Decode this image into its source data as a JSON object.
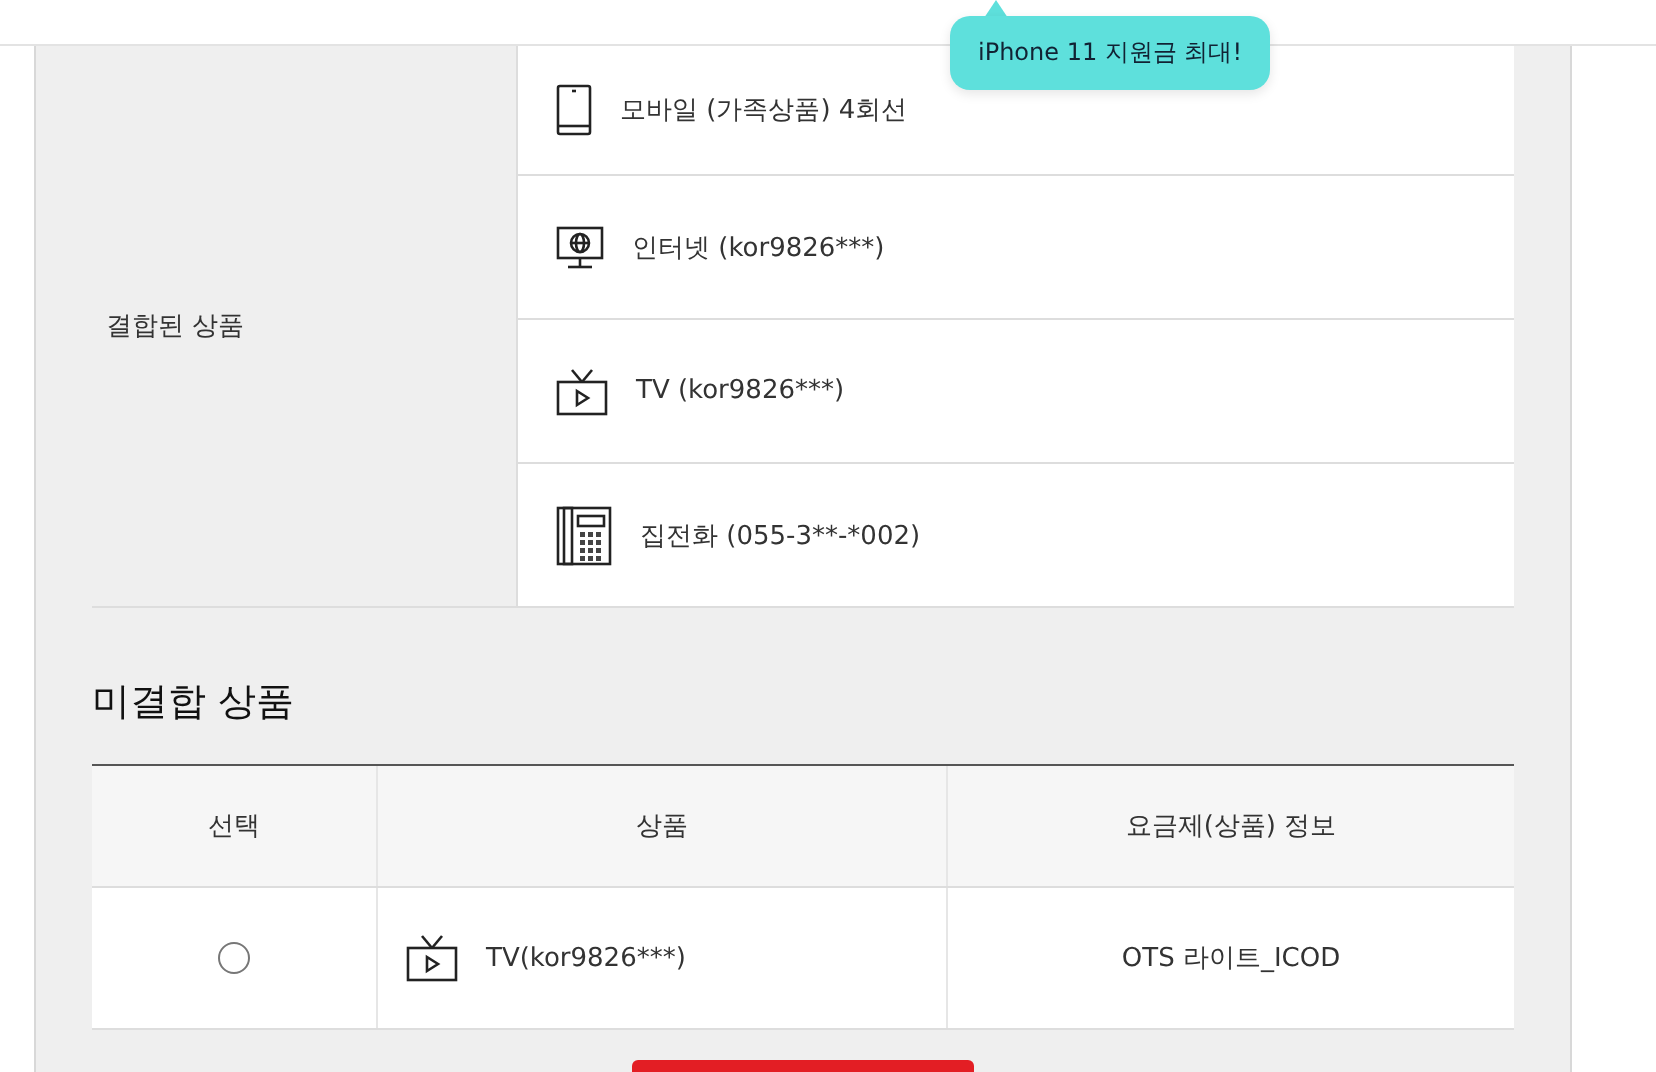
{
  "tooltip": {
    "text": "iPhone 11 지원금 최대!"
  },
  "combined": {
    "label": "결합된 상품",
    "items": [
      {
        "kind": "mobile",
        "text": "모바일 (가족상품) 4회선"
      },
      {
        "kind": "internet",
        "text": "인터넷 (kor9826***)"
      },
      {
        "kind": "tv",
        "text": "TV (kor9826***)"
      },
      {
        "kind": "phone",
        "text": "집전화 (055-3**-*002)"
      }
    ]
  },
  "uncombined": {
    "title": "미결합 상품",
    "columns": [
      "선택",
      "상품",
      "요금제(상품) 정보"
    ],
    "rows": [
      {
        "selected": false,
        "kind": "tv",
        "product": "TV(kor9826***)",
        "plan": "OTS 라이트_ICOD"
      }
    ]
  }
}
